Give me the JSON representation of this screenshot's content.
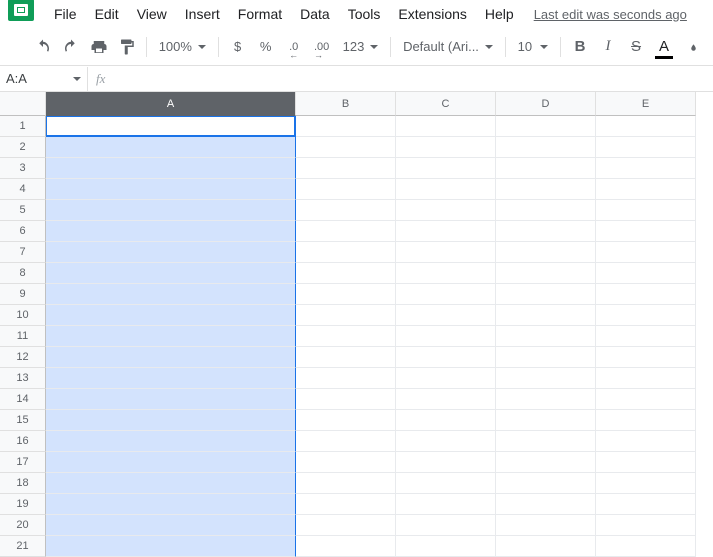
{
  "menu": {
    "file": "File",
    "edit": "Edit",
    "view": "View",
    "insert": "Insert",
    "format": "Format",
    "data": "Data",
    "tools": "Tools",
    "extensions": "Extensions",
    "help": "Help",
    "last_edit": "Last edit was seconds ago"
  },
  "toolbar": {
    "zoom": "100%",
    "currency": "$",
    "percent": "%",
    "dec_decrease": ".0",
    "dec_increase": ".00",
    "format_label": "123",
    "font": "Default (Ari...",
    "font_size": "10",
    "bold": "B",
    "italic": "I",
    "strike": "S",
    "text_color": "A"
  },
  "namebox": {
    "value": "A:A",
    "fx": "fx"
  },
  "columns": [
    "A",
    "B",
    "C",
    "D",
    "E"
  ],
  "rows": [
    "1",
    "2",
    "3",
    "4",
    "5",
    "6",
    "7",
    "8",
    "9",
    "10",
    "11",
    "12",
    "13",
    "14",
    "15",
    "16",
    "17",
    "18",
    "19",
    "20",
    "21"
  ],
  "selection": {
    "column": "A",
    "active_row": "1"
  }
}
